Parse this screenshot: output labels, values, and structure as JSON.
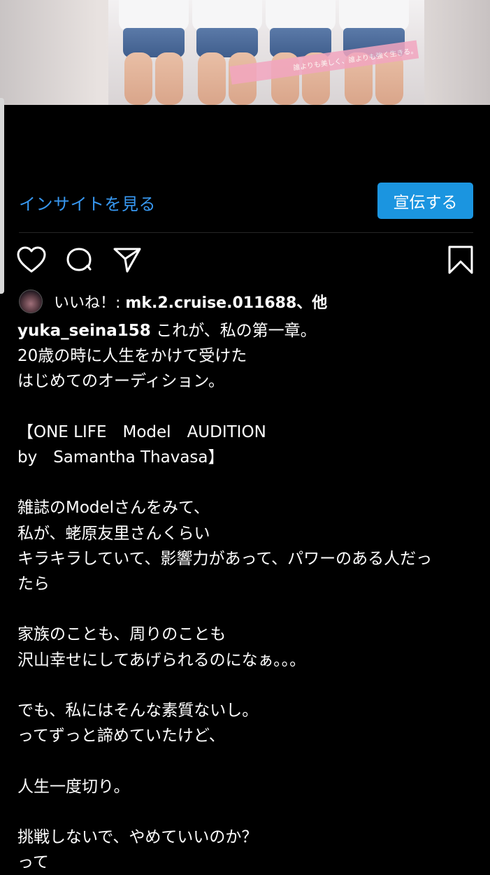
{
  "post_image": {
    "banner_text": "誰よりも美しく、誰よりも強く生きる。"
  },
  "insight_label": "インサイトを見る",
  "promote_label": "宣伝する",
  "actions": {
    "like_icon": "heart-icon",
    "comment_icon": "comment-icon",
    "share_icon": "send-icon",
    "save_icon": "bookmark-icon"
  },
  "likes": {
    "prefix": "いいね！: ",
    "user": "mk.2.cruise.011688",
    "suffix": "、他"
  },
  "caption": {
    "username": "yuka_seina158",
    "first_line": " これが、私の第一章。",
    "lines": [
      "20歳の時に人生をかけて受けた",
      "はじめてのオーディション。",
      "",
      "【ONE LIFE　Model　AUDITION",
      "by　Samantha Thavasa】",
      "",
      "雑誌のModelさんをみて、",
      "私が、蛯原友里さんくらい",
      "キラキラしていて、影響力があって、パワーのある人だっ",
      "たら",
      "",
      "家族のことも、周りのことも",
      "沢山幸せにしてあげられるのになぁ。。。",
      "",
      "でも、私にはそんな素質ないし。",
      "ってずっと諦めていたけど、",
      "",
      "人生一度切り。",
      "",
      "挑戦しないで、やめていいのか？",
      "って"
    ]
  },
  "colors": {
    "link": "#3797f0",
    "button": "#1b95e0",
    "background": "#000000"
  }
}
